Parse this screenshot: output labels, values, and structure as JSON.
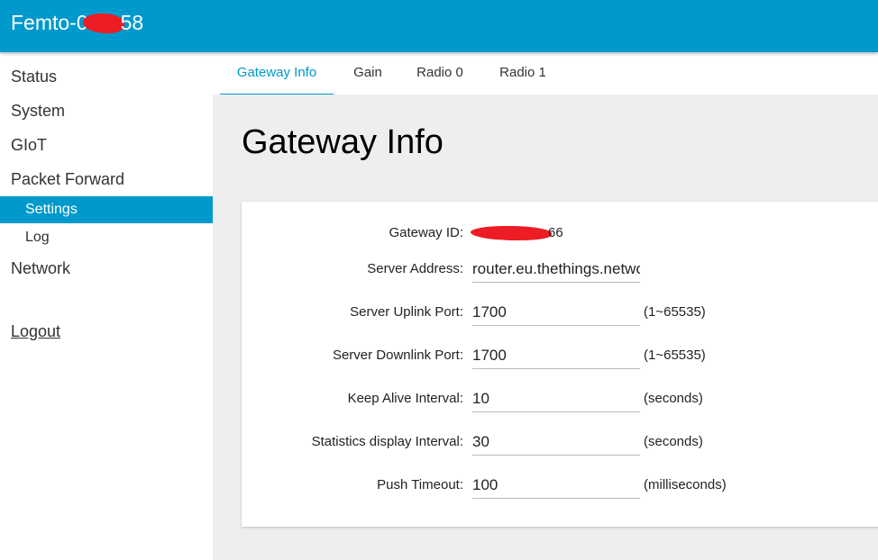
{
  "header": {
    "title_prefix": "Femto-0",
    "title_suffix": "58",
    "accent": "#0099cc"
  },
  "sidebar": {
    "items": [
      "Status",
      "System",
      "GIoT",
      "Packet Forward"
    ],
    "sub_items": [
      "Settings",
      "Log"
    ],
    "network": "Network",
    "logout": "Logout"
  },
  "tabs": [
    "Gateway Info",
    "Gain",
    "Radio 0",
    "Radio 1"
  ],
  "page": {
    "title": "Gateway Info"
  },
  "form": {
    "gateway_id": {
      "label": "Gateway ID:",
      "value_suffix": "66"
    },
    "fields": [
      {
        "label": "Server Address:",
        "value": "router.eu.thethings.network",
        "unit": ""
      },
      {
        "label": "Server Uplink Port:",
        "value": "1700",
        "unit": "(1~65535)"
      },
      {
        "label": "Server Downlink Port:",
        "value": "1700",
        "unit": "(1~65535)"
      },
      {
        "label": "Keep Alive Interval:",
        "value": "10",
        "unit": "(seconds)"
      },
      {
        "label": "Statistics display Interval:",
        "value": "30",
        "unit": "(seconds)"
      },
      {
        "label": "Push Timeout:",
        "value": "100",
        "unit": "(milliseconds)"
      }
    ]
  }
}
